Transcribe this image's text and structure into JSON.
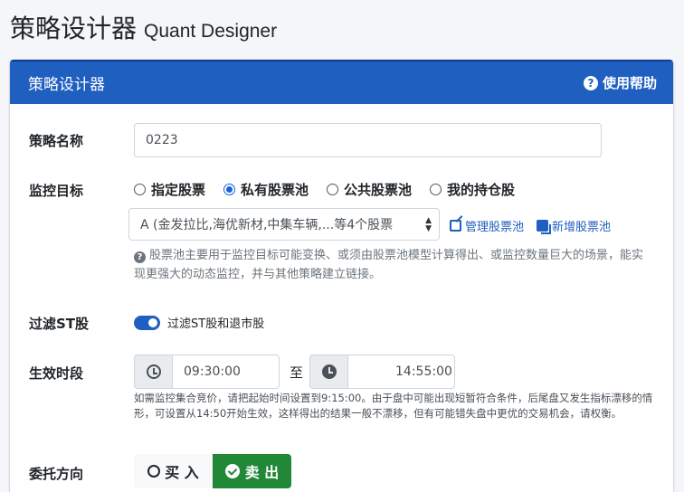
{
  "page": {
    "title": "策略设计器",
    "subtitle": "Quant Designer"
  },
  "card": {
    "title": "策略设计器",
    "help_label": "使用帮助"
  },
  "strategy_name": {
    "label": "策略名称",
    "value": "0223"
  },
  "monitor_target": {
    "label": "监控目标",
    "options": [
      "指定股票",
      "私有股票池",
      "公共股票池",
      "我的持仓股"
    ],
    "selected_index": 1,
    "pool_select_value": "A (金发拉比,海优新材,中集车辆,...等4个股票",
    "manage_link": "管理股票池",
    "add_link": "新增股票池",
    "hint": "股票池主要用于监控目标可能变换、或须由股票池模型计算得出、或监控数量巨大的场景，能实现更强大的动态监控，并与其他策略建立链接。"
  },
  "filter_st": {
    "label": "过滤ST股",
    "toggle_label": "过滤ST股和退市股",
    "enabled": true
  },
  "effective_period": {
    "label": "生效时段",
    "start": "09:30:00",
    "separator": "至",
    "end": "14:55:00",
    "hint": "如需监控集合竞价，请把起始时间设置到9:15:00。由于盘中可能出现短暂符合条件，后尾盘又发生指标漂移的情形，可设置从14:50开始生效，这样得出的结果一般不漂移，但有可能错失盘中更优的交易机会，请权衡。"
  },
  "order_direction": {
    "label": "委托方向",
    "buy_label": "买 入",
    "sell_label": "卖 出",
    "selected": "sell"
  },
  "colors": {
    "header_blue": "#1f5fbf",
    "sell_green": "#218838"
  }
}
